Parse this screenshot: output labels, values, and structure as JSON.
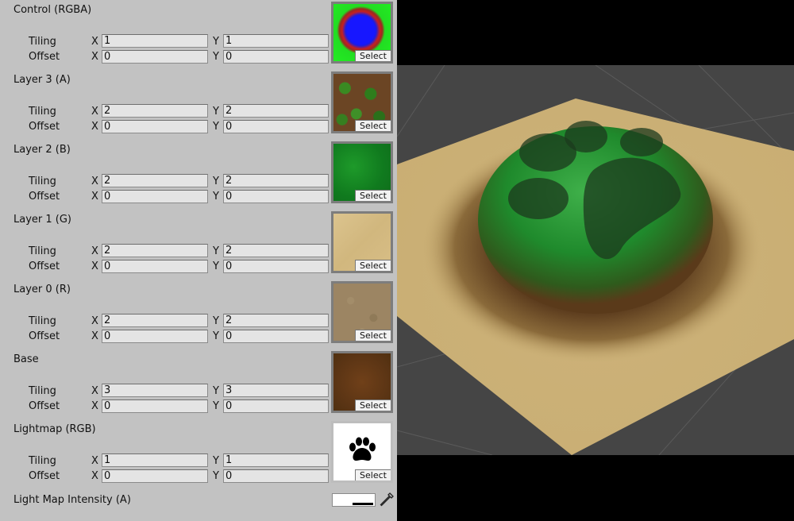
{
  "layers": [
    {
      "title": "Control (RGBA)",
      "tiling_label": "Tiling",
      "offset_label": "Offset",
      "tiling": {
        "x": "1",
        "y": "1"
      },
      "offset": {
        "x": "0",
        "y": "0"
      },
      "select_label": "Select"
    },
    {
      "title": "Layer 3 (A)",
      "tiling_label": "Tiling",
      "offset_label": "Offset",
      "tiling": {
        "x": "2",
        "y": "2"
      },
      "offset": {
        "x": "0",
        "y": "0"
      },
      "select_label": "Select"
    },
    {
      "title": "Layer 2 (B)",
      "tiling_label": "Tiling",
      "offset_label": "Offset",
      "tiling": {
        "x": "2",
        "y": "2"
      },
      "offset": {
        "x": "0",
        "y": "0"
      },
      "select_label": "Select"
    },
    {
      "title": "Layer 1 (G)",
      "tiling_label": "Tiling",
      "offset_label": "Offset",
      "tiling": {
        "x": "2",
        "y": "2"
      },
      "offset": {
        "x": "0",
        "y": "0"
      },
      "select_label": "Select"
    },
    {
      "title": "Layer 0 (R)",
      "tiling_label": "Tiling",
      "offset_label": "Offset",
      "tiling": {
        "x": "2",
        "y": "2"
      },
      "offset": {
        "x": "0",
        "y": "0"
      },
      "select_label": "Select"
    },
    {
      "title": "Base",
      "tiling_label": "Tiling",
      "offset_label": "Offset",
      "tiling": {
        "x": "3",
        "y": "3"
      },
      "offset": {
        "x": "0",
        "y": "0"
      },
      "select_label": "Select"
    },
    {
      "title": "Lightmap (RGB)",
      "tiling_label": "Tiling",
      "offset_label": "Offset",
      "tiling": {
        "x": "1",
        "y": "1"
      },
      "offset": {
        "x": "0",
        "y": "0"
      },
      "select_label": "Select"
    }
  ],
  "axis_labels": {
    "x": "X",
    "y": "Y"
  },
  "light_map_intensity": {
    "label": "Light Map Intensity (A)",
    "color": "#ffffff",
    "icon": "eyedropper-icon"
  },
  "icons": {
    "lightmap_thumbnail": "paw-print-icon"
  },
  "colors": {
    "inspector_bg": "#c2c2c2",
    "viewport_bg": "#454545",
    "field_bg": "#e4e4e4"
  }
}
